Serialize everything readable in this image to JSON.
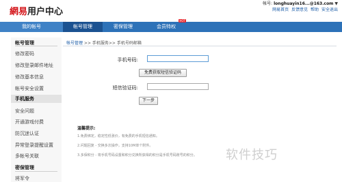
{
  "header": {
    "logo_brand": "網易",
    "logo_title": "用户中心",
    "account_label": "帐号:",
    "account_value": "longhuayin16...@163.com",
    "account_arrow": "▼",
    "links": [
      "网易首页",
      "反馈意见",
      "帮助",
      "安全退出"
    ]
  },
  "nav": {
    "tabs": [
      "我的帐号",
      "帐号管理",
      "密保管理",
      "会员特权"
    ],
    "hot_badge": "HOT"
  },
  "sidebar": {
    "items": [
      {
        "label": "帐号管理",
        "type": "group"
      },
      {
        "label": "修改密码",
        "type": "item"
      },
      {
        "label": "修改登录邮件地址",
        "type": "item"
      },
      {
        "label": "修改基本信息",
        "type": "item"
      },
      {
        "label": "帐号安全设置",
        "type": "item"
      },
      {
        "label": "手机服务",
        "type": "active"
      },
      {
        "label": "安全问题",
        "type": "item"
      },
      {
        "label": "开通游戏付费",
        "type": "item"
      },
      {
        "label": "防沉迷认证",
        "type": "item"
      },
      {
        "label": "异常登录提醒设置",
        "type": "item"
      },
      {
        "label": "多帐号关联",
        "type": "item"
      },
      {
        "label": "密保管理",
        "type": "group"
      },
      {
        "label": "将军令",
        "type": "item"
      }
    ]
  },
  "main": {
    "breadcrumb": {
      "part1": "帐号管理",
      "sep1": " >> ",
      "part2": "手机服务",
      "sep2": ">> ",
      "part3": "手机号码邮箱"
    },
    "form": {
      "phone_label": "手机号码:",
      "phone_value": "",
      "get_code_button": "免费获取短信验证码",
      "code_label": "短信验证码:",
      "code_value": "",
      "next_button": "下一步"
    },
    "tips": {
      "title": "温馨提示:",
      "items": [
        "1.免费绑定，稳定性低涨价，有免费的手机短信通知。",
        "2.问题回复 - 交换多次操作，支持10M单个附件。",
        "3.多保积分 - 将手机号码设置和积分兑换所获得的积分是手机号码账号的积分。"
      ]
    }
  },
  "watermark": "软件技巧"
}
